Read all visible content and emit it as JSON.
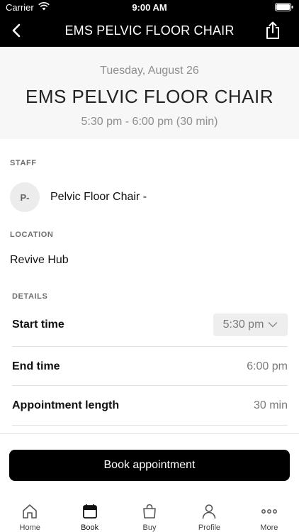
{
  "status_bar": {
    "carrier": "Carrier",
    "time": "9:00 AM"
  },
  "nav": {
    "title": "EMS PELVIC FLOOR CHAIR"
  },
  "header": {
    "date": "Tuesday, August 26",
    "title": "EMS PELVIC FLOOR CHAIR",
    "time_range": "5:30 pm - 6:00 pm (30 min)"
  },
  "staff": {
    "label": "STAFF",
    "initials": "P-",
    "name": "Pelvic Floor Chair -"
  },
  "location": {
    "label": "LOCATION",
    "name": "Revive Hub"
  },
  "details": {
    "label": "DETAILS",
    "start_time_label": "Start time",
    "start_time_value": "5:30 pm",
    "end_time_label": "End time",
    "end_time_value": "6:00 pm",
    "length_label": "Appointment length",
    "length_value": "30 min"
  },
  "book_button": "Book appointment",
  "tabs": [
    {
      "label": "Home",
      "icon": "home-icon"
    },
    {
      "label": "Book",
      "icon": "calendar-icon"
    },
    {
      "label": "Buy",
      "icon": "shopping-bag-icon"
    },
    {
      "label": "Profile",
      "icon": "profile-icon"
    },
    {
      "label": "More",
      "icon": "more-icon"
    }
  ],
  "colors": {
    "primary": "#000000",
    "header_bg": "#f7f7f7",
    "muted_text": "#8e8e8e"
  }
}
